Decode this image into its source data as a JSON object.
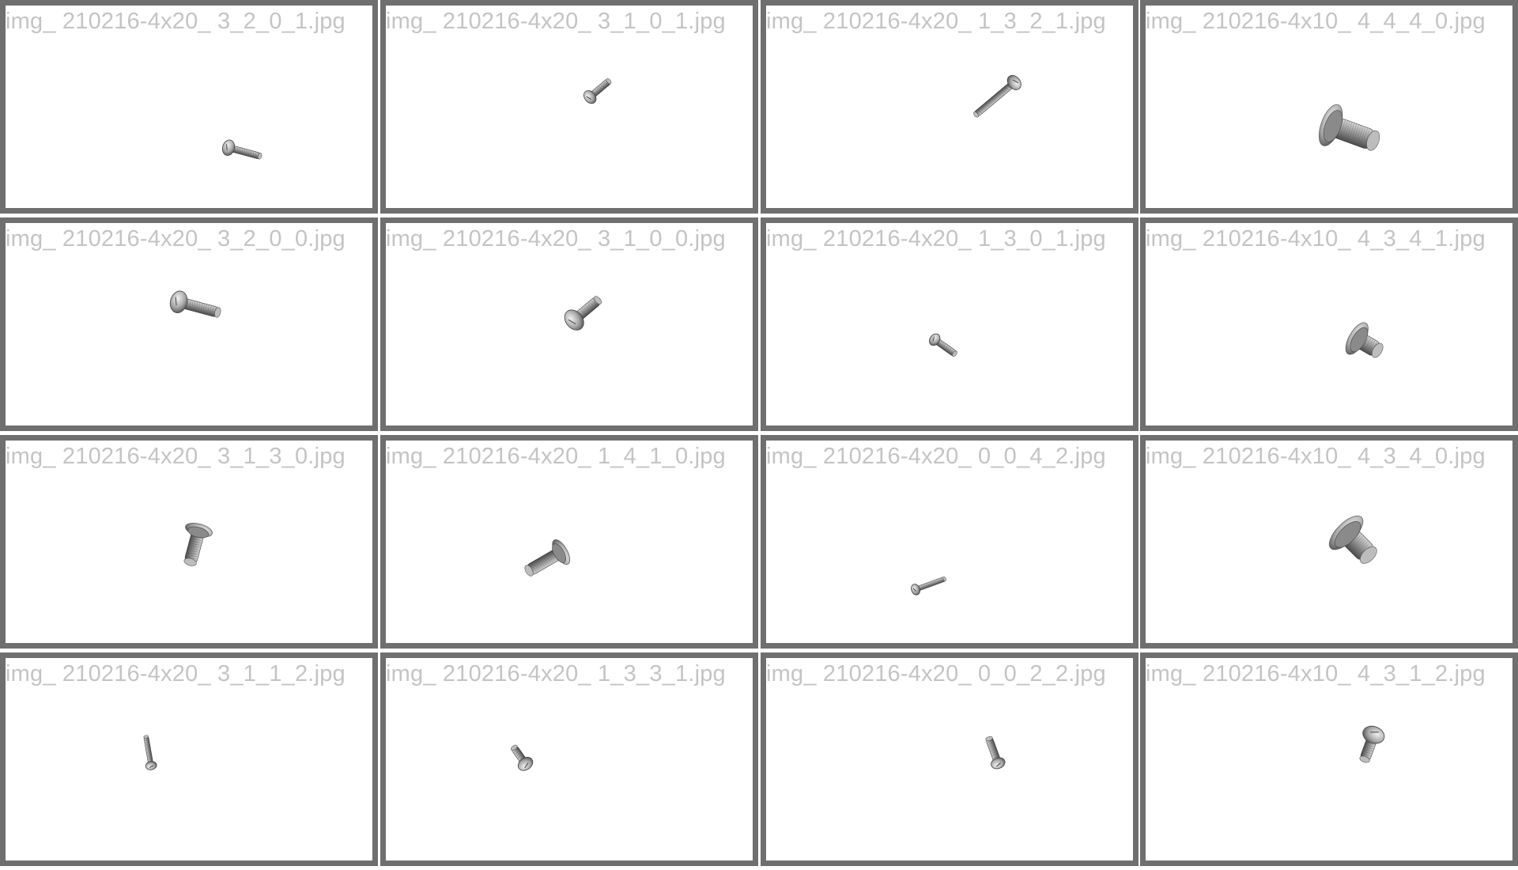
{
  "tiles": [
    {
      "label": "img_ 210216-4x20_ 3_2_0_1.jpg",
      "screw": {
        "type": "pan"
      }
    },
    {
      "label": "img_ 210216-4x20_ 3_1_0_1.jpg",
      "screw": {
        "type": "pan"
      }
    },
    {
      "label": "img_ 210216-4x20_ 1_3_2_1.jpg",
      "screw": {
        "type": "pan"
      }
    },
    {
      "label": "img_ 210216-4x10_ 4_4_4_0.jpg",
      "screw": {
        "type": "washer"
      }
    },
    {
      "label": "img_ 210216-4x20_ 3_2_0_0.jpg",
      "screw": {
        "type": "pan"
      }
    },
    {
      "label": "img_ 210216-4x20_ 3_1_0_0.jpg",
      "screw": {
        "type": "pan"
      }
    },
    {
      "label": "img_ 210216-4x20_ 1_3_0_1.jpg",
      "screw": {
        "type": "pan"
      }
    },
    {
      "label": "img_ 210216-4x10_ 4_3_4_1.jpg",
      "screw": {
        "type": "washer"
      }
    },
    {
      "label": "img_ 210216-4x20_ 3_1_3_0.jpg",
      "screw": {
        "type": "washer"
      }
    },
    {
      "label": "img_ 210216-4x20_ 1_4_1_0.jpg",
      "screw": {
        "type": "washer"
      }
    },
    {
      "label": "img_ 210216-4x20_ 0_0_4_2.jpg",
      "screw": {
        "type": "pan"
      }
    },
    {
      "label": "img_ 210216-4x10_ 4_3_4_0.jpg",
      "screw": {
        "type": "washer"
      }
    },
    {
      "label": "img_ 210216-4x20_ 3_1_1_2.jpg",
      "screw": {
        "type": "pan"
      }
    },
    {
      "label": "img_ 210216-4x20_ 1_3_3_1.jpg",
      "screw": {
        "type": "pan"
      }
    },
    {
      "label": "img_ 210216-4x20_ 0_0_2_2.jpg",
      "screw": {
        "type": "pan"
      }
    },
    {
      "label": "img_ 210216-4x10_ 4_3_1_2.jpg",
      "screw": {
        "type": "pan"
      }
    }
  ]
}
